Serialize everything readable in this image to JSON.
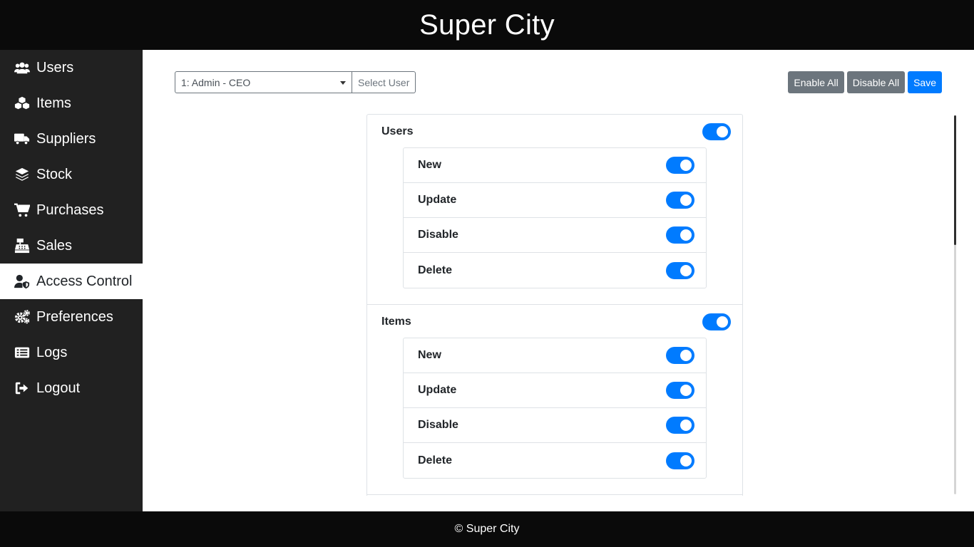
{
  "app": {
    "title": "Super City"
  },
  "sidebar": {
    "items": [
      {
        "label": "Users",
        "icon": "users-icon"
      },
      {
        "label": "Items",
        "icon": "cubes-icon"
      },
      {
        "label": "Suppliers",
        "icon": "truck-icon"
      },
      {
        "label": "Stock",
        "icon": "layers-icon"
      },
      {
        "label": "Purchases",
        "icon": "cart-icon"
      },
      {
        "label": "Sales",
        "icon": "cash-register-icon"
      },
      {
        "label": "Access Control",
        "icon": "user-shield-icon",
        "active": true
      },
      {
        "label": "Preferences",
        "icon": "gears-icon"
      },
      {
        "label": "Logs",
        "icon": "list-icon"
      },
      {
        "label": "Logout",
        "icon": "sign-out-icon"
      }
    ]
  },
  "user_select": {
    "value": "1: Admin - CEO",
    "button_label": "Select User"
  },
  "actions": {
    "enable_all": "Enable All",
    "disable_all": "Disable All",
    "save": "Save"
  },
  "permissions": [
    {
      "title": "Users",
      "enabled": true,
      "items": [
        {
          "label": "New",
          "enabled": true
        },
        {
          "label": "Update",
          "enabled": true
        },
        {
          "label": "Disable",
          "enabled": true
        },
        {
          "label": "Delete",
          "enabled": true
        }
      ]
    },
    {
      "title": "Items",
      "enabled": true,
      "items": [
        {
          "label": "New",
          "enabled": true
        },
        {
          "label": "Update",
          "enabled": true
        },
        {
          "label": "Disable",
          "enabled": true
        },
        {
          "label": "Delete",
          "enabled": true
        }
      ]
    }
  ],
  "footer": {
    "text": "© Super City"
  },
  "colors": {
    "accent": "#007bff",
    "sidebar_bg": "#212121",
    "header_bg": "#0a0a0a",
    "gray_button": "#6c757d"
  }
}
